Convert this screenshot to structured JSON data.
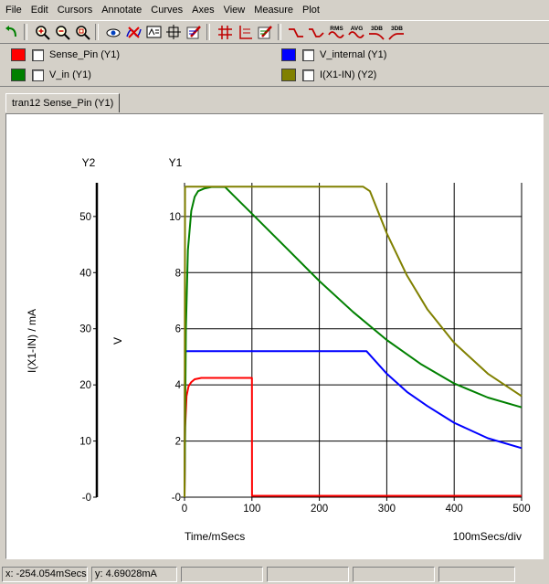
{
  "menu": [
    "File",
    "Edit",
    "Cursors",
    "Annotate",
    "Curves",
    "Axes",
    "View",
    "Measure",
    "Plot"
  ],
  "toolbar": {
    "icons": [
      "undo-icon",
      "zoom-in-icon",
      "zoom-out-icon",
      "zoom-fit-icon",
      "view-icon",
      "delete-curve-icon",
      "text-annotate-icon",
      "crosshair-icon",
      "pen-icon",
      "grid-icon",
      "axis-icon",
      "pen-annotate-icon",
      "rise-edge-icon",
      "fall-edge-icon",
      "rms-icon",
      "avg-icon",
      "3db-lowpass-icon",
      "3db-highpass-icon"
    ],
    "rms_label": "RMS",
    "avg_label": "AVG",
    "db1_label": "3DB",
    "db2_label": "3DB"
  },
  "legend": [
    {
      "name": "Sense_Pin (Y1)",
      "color": "#ff0000"
    },
    {
      "name": "V_internal (Y1)",
      "color": "#0000ff"
    },
    {
      "name": "V_in (Y1)",
      "color": "#008000"
    },
    {
      "name": "I(X1-IN) (Y2)",
      "color": "#808000"
    }
  ],
  "tab": {
    "label": "tran12 Sense_Pin (Y1)"
  },
  "plot": {
    "y2_title": "Y2",
    "y1_title": "Y1",
    "y2_label": "I(X1-IN) / mA",
    "y1_label": "V",
    "x_label": "Time/mSecs",
    "x_div": "100mSecs/div"
  },
  "chart_data": {
    "type": "line",
    "xlabel": "Time/mSecs",
    "xlim": [
      0,
      500
    ],
    "x_ticks": [
      "0",
      "100",
      "200",
      "300",
      "400",
      "500"
    ],
    "y1": {
      "label": "V",
      "title": "Y1",
      "ylim": [
        0,
        11.2
      ],
      "ticks": [
        "-0",
        "2",
        "4",
        "6",
        "8",
        "10"
      ]
    },
    "y2": {
      "label": "I(X1-IN) / mA",
      "title": "Y2",
      "ylim": [
        0,
        56
      ],
      "ticks": [
        "-0",
        "10",
        "20",
        "30",
        "40",
        "50"
      ]
    },
    "grid": true,
    "series": [
      {
        "name": "Sense_Pin (Y1)",
        "color": "#ff0000",
        "axis": "y1",
        "x": [
          0,
          1,
          3,
          6,
          10,
          15,
          25,
          50,
          100,
          100.1,
          500
        ],
        "y": [
          0,
          2.5,
          3.6,
          3.95,
          4.1,
          4.2,
          4.25,
          4.25,
          4.25,
          0.05,
          0.05
        ]
      },
      {
        "name": "V_internal (Y1)",
        "color": "#0000ff",
        "axis": "y1",
        "x": [
          0,
          0.5,
          1,
          2,
          270,
          300,
          330,
          360,
          400,
          450,
          500
        ],
        "y": [
          0,
          4.0,
          5.1,
          5.2,
          5.2,
          4.4,
          3.75,
          3.25,
          2.65,
          2.1,
          1.75
        ]
      },
      {
        "name": "V_in (Y1)",
        "color": "#008000",
        "axis": "y1",
        "x": [
          0,
          2,
          5,
          10,
          15,
          20,
          30,
          40,
          60,
          100,
          150,
          200,
          250,
          300,
          350,
          400,
          450,
          500
        ],
        "y": [
          0,
          6.0,
          8.8,
          10.2,
          10.7,
          10.9,
          11.0,
          11.05,
          11.05,
          10.1,
          8.9,
          7.7,
          6.6,
          5.6,
          4.75,
          4.05,
          3.55,
          3.2
        ]
      },
      {
        "name": "I(X1-IN) (Y2)",
        "color": "#808000",
        "axis": "y2",
        "x": [
          0,
          0.8,
          2,
          5,
          265,
          275,
          300,
          330,
          360,
          400,
          450,
          500
        ],
        "y": [
          0,
          55.2,
          55.3,
          55.3,
          55.3,
          54.5,
          47.0,
          39.5,
          33.5,
          27.5,
          22.0,
          18.0
        ]
      }
    ]
  },
  "status": {
    "x": "x: -254.054mSecs",
    "y": "y: 4.69028mA"
  }
}
